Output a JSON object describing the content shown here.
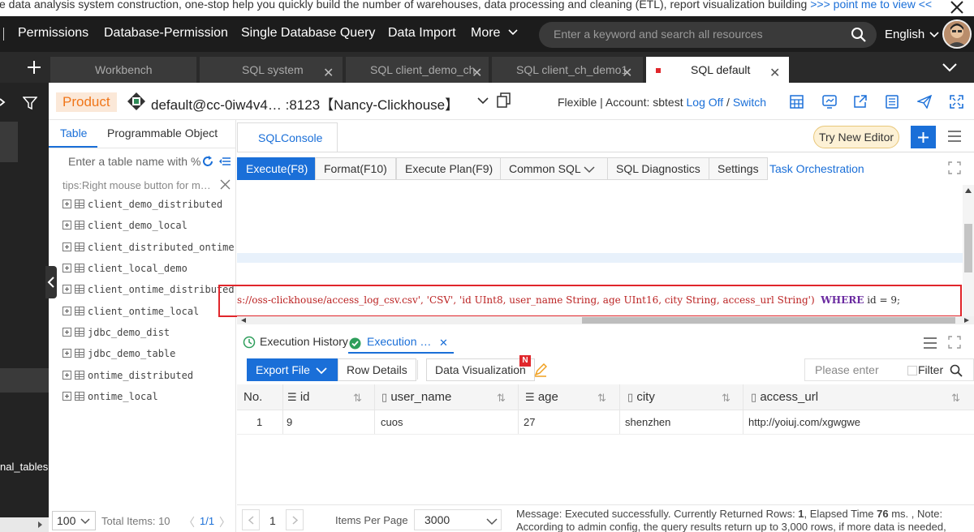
{
  "banner": {
    "text": "e data analysis system construction, one-stop help you quickly build the number of warehouses, data processing and cleaning (ETL), report visualization building ",
    "link": ">>> point me to view <<"
  },
  "nav": {
    "items": [
      "Permissions",
      "Database-Permission",
      "Single Database Query",
      "Data Import",
      "More"
    ],
    "search_placeholder": "Enter a keyword and search all resources",
    "language": "English"
  },
  "tabs": [
    {
      "label": "Workbench",
      "active": false
    },
    {
      "label": "SQL system",
      "active": false
    },
    {
      "label": "SQL client_demo_ch",
      "active": false
    },
    {
      "label": "SQL client_ch_demo1",
      "active": false
    },
    {
      "label": "SQL default",
      "active": true
    }
  ],
  "connection": {
    "badge": "Product",
    "name": "default@cc-0iw4v4… :8123【Nancy-Clickhouse】",
    "mode": "Flexible | Account: sbtest",
    "logoff": "Log Off",
    "slash": " / ",
    "switch": "Switch"
  },
  "left": {
    "tab_table": "Table",
    "tab_programmable": "Programmable Object",
    "search_placeholder": "Enter a table name with %",
    "tips": "tips:Right mouse button for m…",
    "tables": [
      "client_demo_distributed",
      "client_demo_local",
      "client_distributed_ontime",
      "client_local_demo",
      "client_ontime_distributed",
      "client_ontime_local",
      "jdbc_demo_dist",
      "jdbc_demo_table",
      "ontime_distributed",
      "ontime_local"
    ],
    "rail_label": "nal_tables",
    "page_size": "100",
    "total": "Total Items: 10",
    "page": "1/1"
  },
  "console": {
    "tab": "SQLConsole",
    "try_new": "Try New Editor",
    "buttons": [
      "Execute(F8)",
      "Format(F10)",
      "Execute Plan(F9)",
      "Common SQL",
      "SQL Diagnostics",
      "Settings"
    ],
    "task_orchestration": "Task Orchestration",
    "sql_text": "s://oss-clickhouse/access_log_csv.csv', 'CSV', 'id UInt8, user_name String, age UInt16, city String, access_url String')",
    "sql_where": "WHERE",
    "sql_tail": " id = 9;"
  },
  "results": {
    "tab_history": "Execution History",
    "tab_execution": "Execution …",
    "export": "Export File",
    "row_details": "Row Details",
    "data_viz": "Data Visualization",
    "new_badge": "N",
    "filter_placeholder": "Please enter",
    "filter_label": "Filter",
    "columns": [
      "No.",
      "id",
      "user_name",
      "age",
      "city",
      "access_url"
    ],
    "rows": [
      {
        "no": "1",
        "id": "9",
        "user_name": "cuos",
        "age": "27",
        "city": "shenzhen",
        "access_url": "http://yoiuj.com/xgwgwe"
      }
    ],
    "page_num": "1",
    "items_per_page_label": "Items Per Page",
    "items_per_page": "3000",
    "message_prefix": "Message: Executed successfully. Currently Returned Rows: ",
    "rows_returned": "1",
    "elapsed_label": ", Elapsed Time ",
    "elapsed": "76",
    "message_suffix": " ms. ,  Note:",
    "message_line2": "According to admin config, the query results return up to 3,000 rows, if more data is needed,"
  },
  "colors": {
    "accent": "#1a6fd8",
    "nav_bg": "#1c1c1c",
    "product_orange": "#f0761a",
    "highlight_red": "#e0262b"
  }
}
